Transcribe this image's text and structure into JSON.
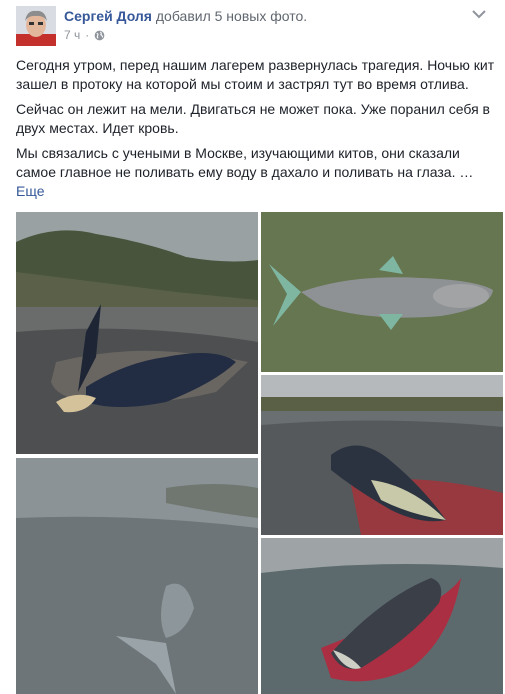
{
  "post": {
    "author": "Сергей Доля",
    "action": "добавил 5 новых фото.",
    "time": "7 ч",
    "privacy_icon": "globe-icon",
    "menu_icon": "chevron-down-icon",
    "paragraphs": [
      "Сегодня утром, перед нашим лагерем развернулась трагедия. Ночью кит зашел в протоку на которой мы стоим и застрял тут во время отлива.",
      "Сейчас он лежит на мели. Двигаться не может пока. Уже поранил себя в двух местах. Идет кровь.",
      "Мы связались с учеными в Москве, изучающими китов, они сказали самое главное не поливать ему воду в дахало и поливать на глаза. …"
    ],
    "see_more": "Еще"
  },
  "colors": {
    "link": "#365899",
    "secondary": "#616770",
    "meta": "#90949c",
    "text": "#1d2129",
    "blood": "#c0272d"
  }
}
